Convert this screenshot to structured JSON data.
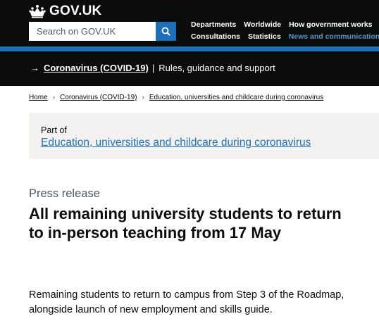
{
  "header": {
    "logo_text": "GOV.UK",
    "search": {
      "placeholder": "Search on GOV.UK"
    },
    "nav_row1": [
      "Departments",
      "Worldwide",
      "How government works"
    ],
    "nav_row2": [
      "Consultations",
      "Statistics",
      "News and communications"
    ]
  },
  "covid_banner": {
    "link": "Coronavirus (COVID-19)",
    "separator": "|",
    "text": "Rules, guidance and support"
  },
  "breadcrumb": [
    "Home",
    "Coronavirus (COVID-19)",
    "Education, universities and childcare during coronavirus"
  ],
  "part_of": {
    "label": "Part of",
    "link": "Education, universities and childcare during coronavirus"
  },
  "article": {
    "caption": "Press release",
    "title": "All remaining university students to return to in-person teaching from 17 May",
    "summary": "Remaining students to return to campus from Step 3 of the Roadmap, alongside launch of new employment and skills guide."
  },
  "colors": {
    "brand_blue": "#1d70b8",
    "black": "#0b0c0c",
    "light_blue": "#5694ca",
    "grey_bg": "#f3f2f1"
  }
}
